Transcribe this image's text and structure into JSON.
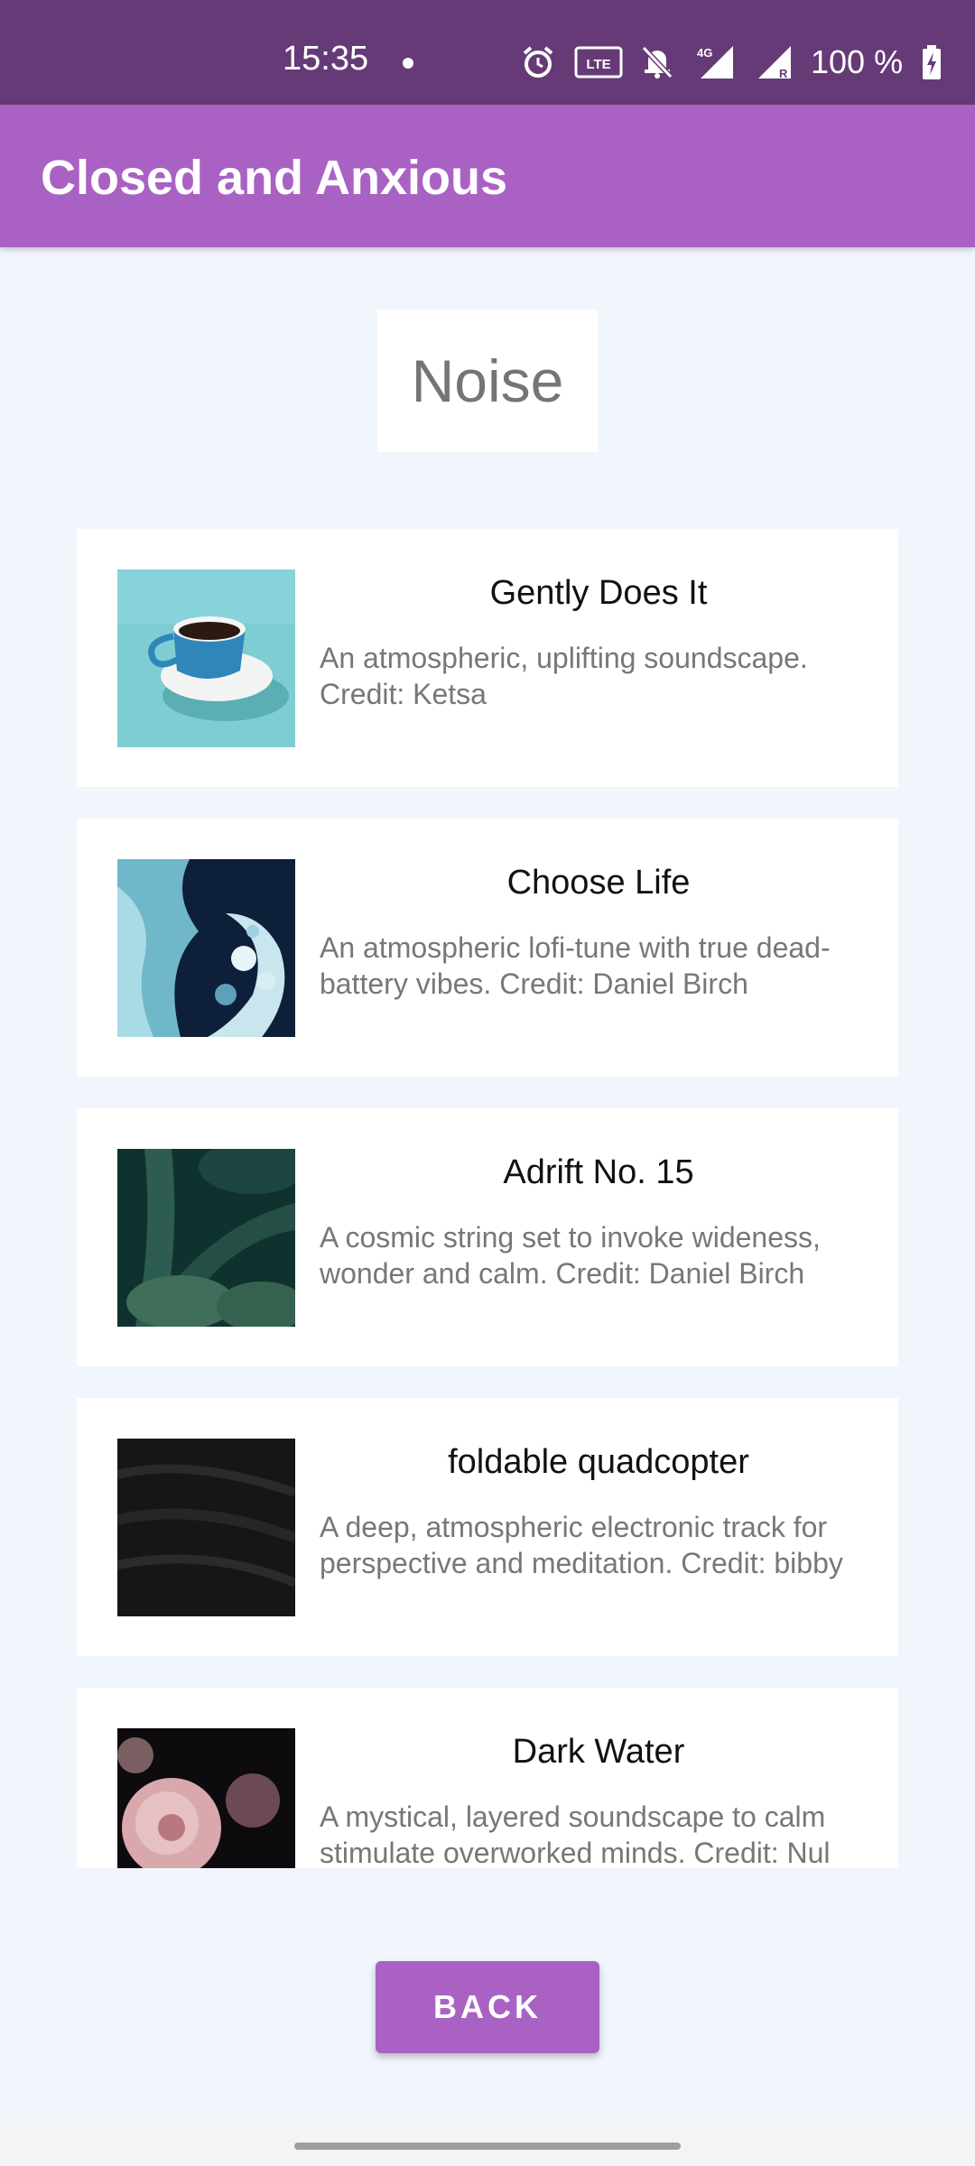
{
  "status_bar": {
    "time": "15:35",
    "battery": "100 %",
    "icons": [
      "alarm-icon",
      "volte-icon",
      "bell-off-icon",
      "signal-4g-icon",
      "signal-r-icon",
      "battery-charging-icon"
    ]
  },
  "app_bar": {
    "title": "Closed and Anxious"
  },
  "section": {
    "title": "Noise"
  },
  "tracks": [
    {
      "title": "Gently Does It",
      "description": "An atmospheric, uplifting soundscape. Credit: Ketsa",
      "image": "coffee-cup-image"
    },
    {
      "title": "Choose Life",
      "description": "An atmospheric lofi-tune with true dead-battery vibes. Credit: Daniel Birch",
      "image": "blue-fluid-art-image"
    },
    {
      "title": "Adrift No. 15",
      "description": "A cosmic string set to invoke wideness, wonder and calm. Credit: Daniel Birch",
      "image": "green-foliage-image"
    },
    {
      "title": "foldable quadcopter",
      "description": "A deep, atmospheric electronic track for perspective and meditation. Credit: bibby",
      "image": "black-sand-image"
    },
    {
      "title": "Dark Water",
      "description": "A mystical, layered soundscape to calm stimulate overworked minds. Credit: Nul",
      "image": "pink-roses-image"
    }
  ],
  "back_button": {
    "label": "BACK"
  },
  "colors": {
    "status_bar": "#653a76",
    "app_bar": "#a962c3",
    "background": "#f1f5fc",
    "button": "#a962c3"
  }
}
